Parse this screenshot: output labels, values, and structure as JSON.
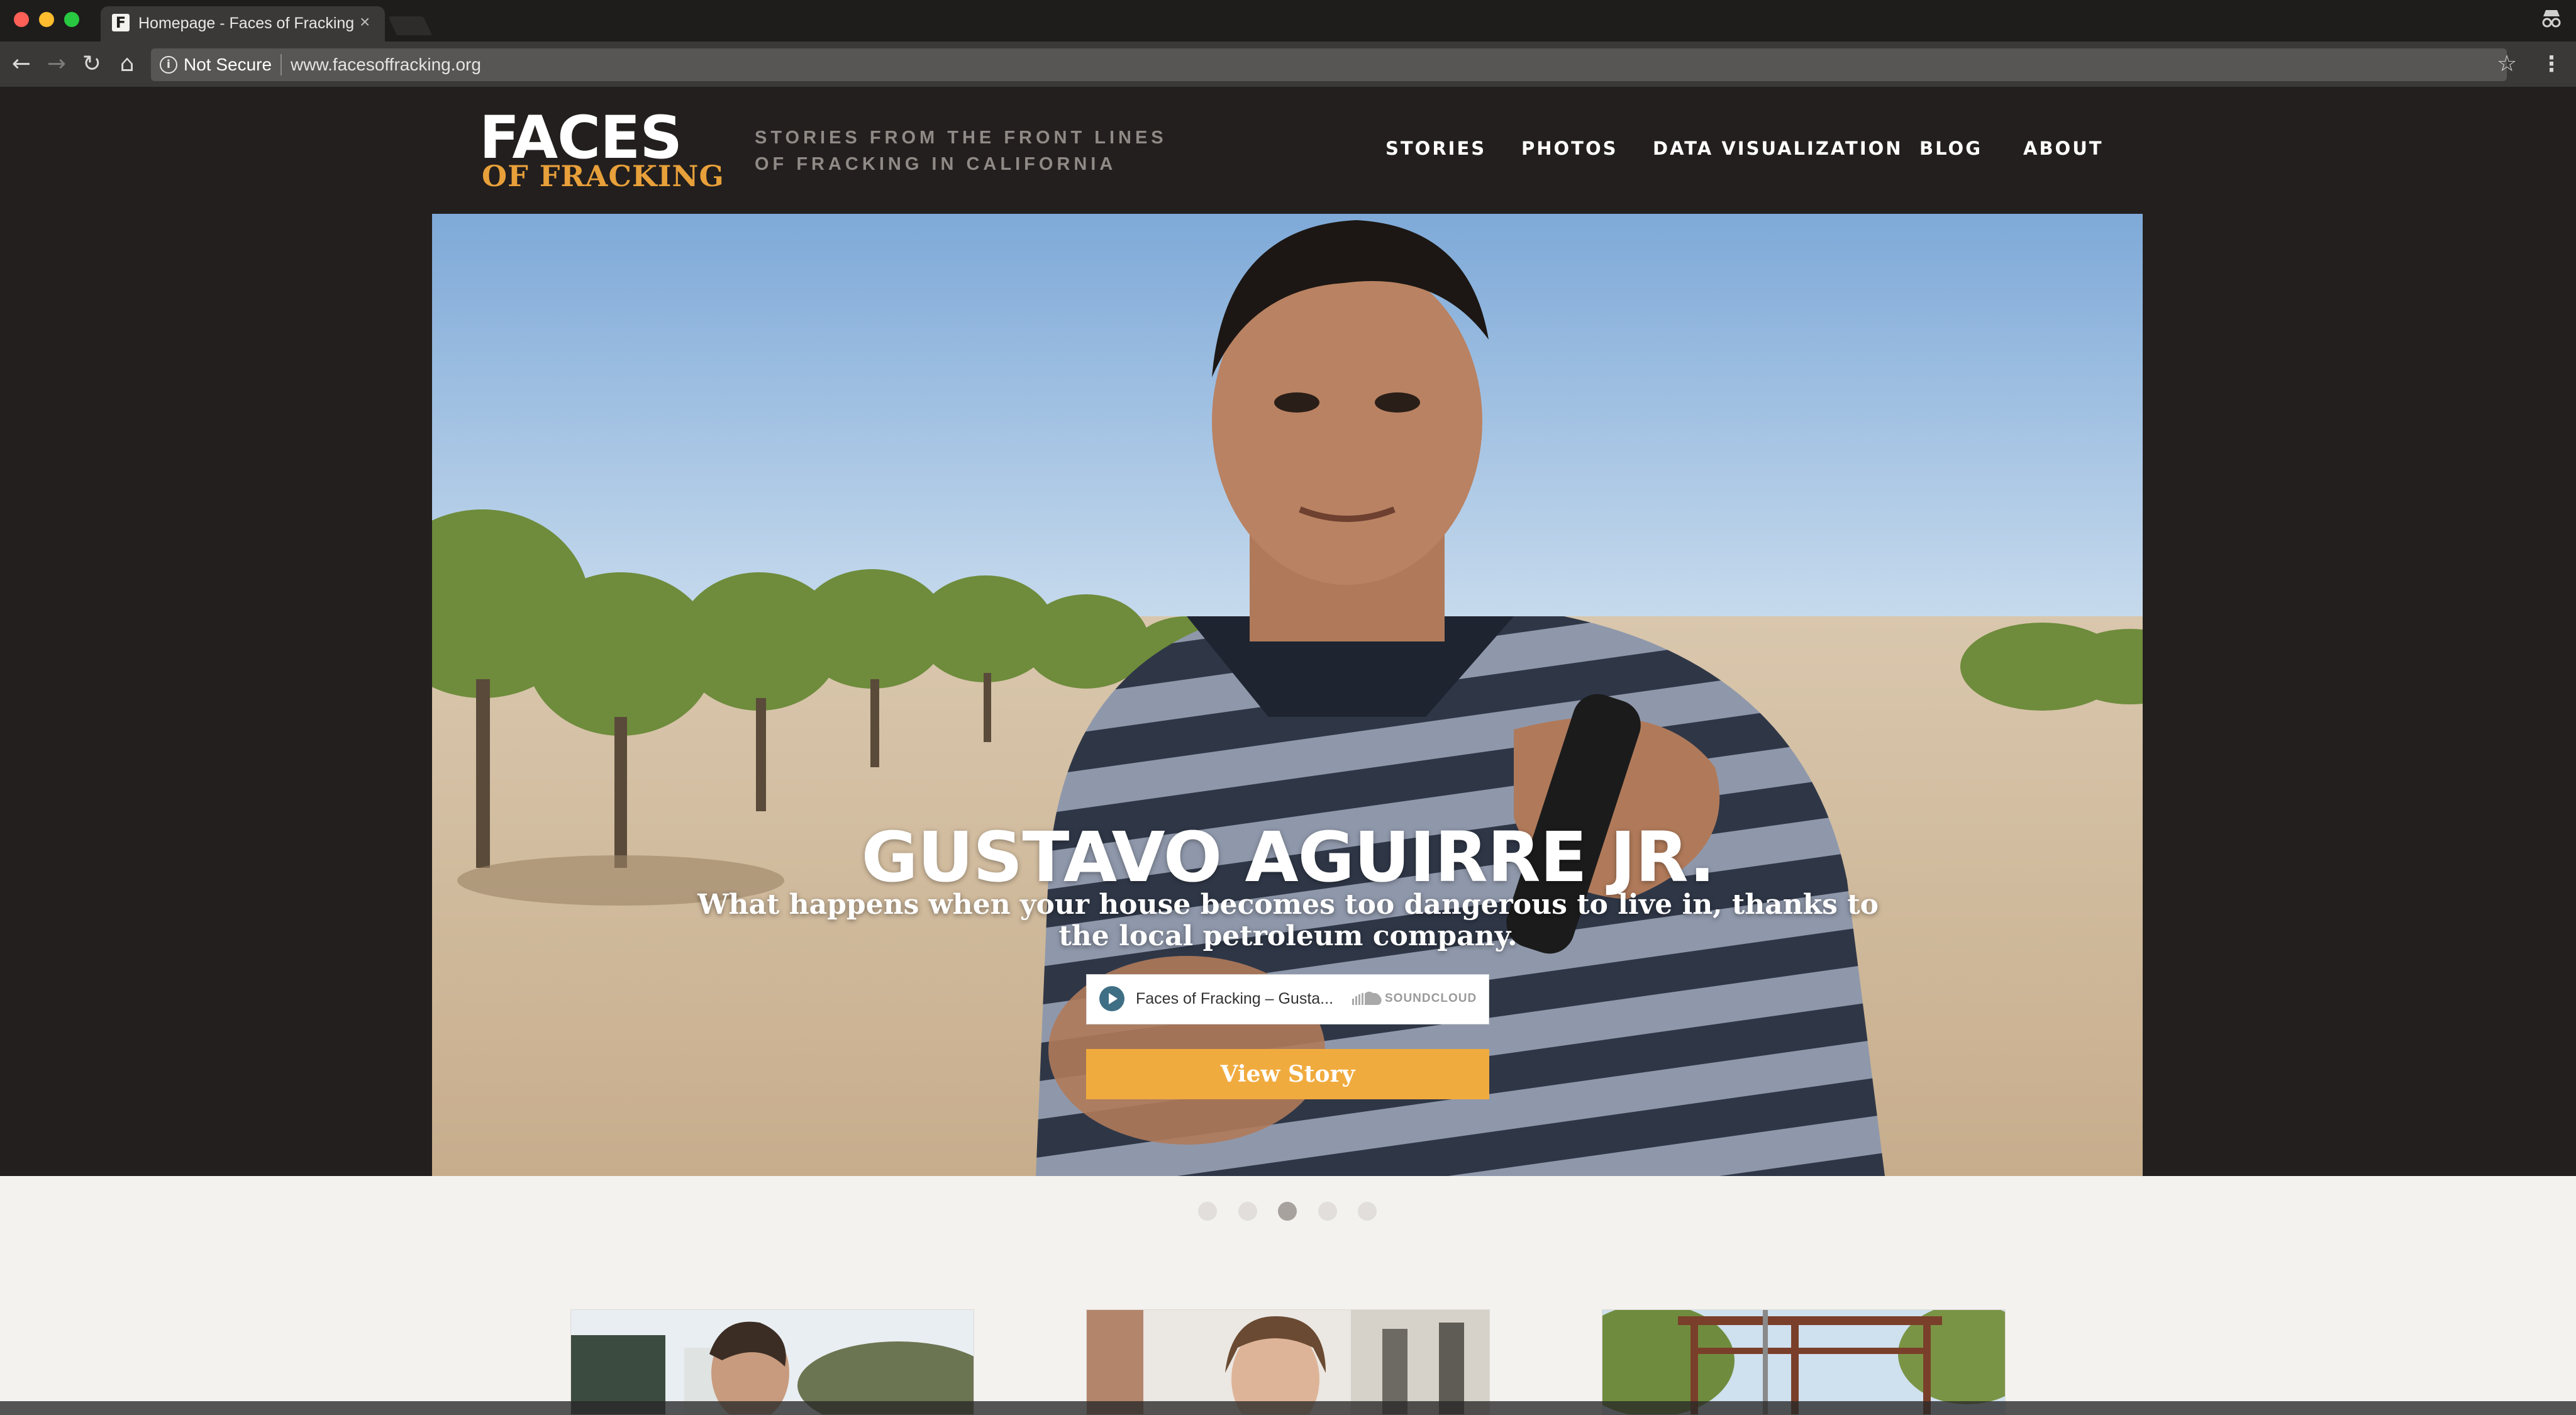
{
  "browser": {
    "tab_title": "Homepage - Faces of Fracking",
    "tab_favicon": "F",
    "tab_close": "×",
    "security_label": "Not Secure",
    "url": "www.facesoffracking.org",
    "icons": [
      "back-icon",
      "forward-icon",
      "reload-icon",
      "home-icon",
      "info-icon",
      "star-icon",
      "menu-icon",
      "incognito-icon"
    ]
  },
  "header": {
    "logo_line1": "FACES",
    "logo_line2": "OF FRACKING",
    "tagline": "STORIES FROM THE FRONT LINES OF FRACKING IN CALIFORNIA",
    "nav": [
      "STORIES",
      "PHOTOS",
      "DATA VISUALIZATION",
      "BLOG",
      "ABOUT"
    ]
  },
  "hero": {
    "title": "GUSTAVO AGUIRRE JR.",
    "description": "What happens when your house becomes too dangerous to live in, thanks to the local petroleum company.",
    "player": {
      "track_title": "Faces of Fracking – Gusta...",
      "provider": "SOUNDCLOUD"
    },
    "cta_label": "View Story"
  },
  "carousel": {
    "slide_count": 5,
    "active_index": 2
  },
  "colors": {
    "header_bg": "#231f1e",
    "accent": "#f0ab3f",
    "logo_orange": "#e8a03a",
    "page_bg": "#f4f2ef"
  }
}
